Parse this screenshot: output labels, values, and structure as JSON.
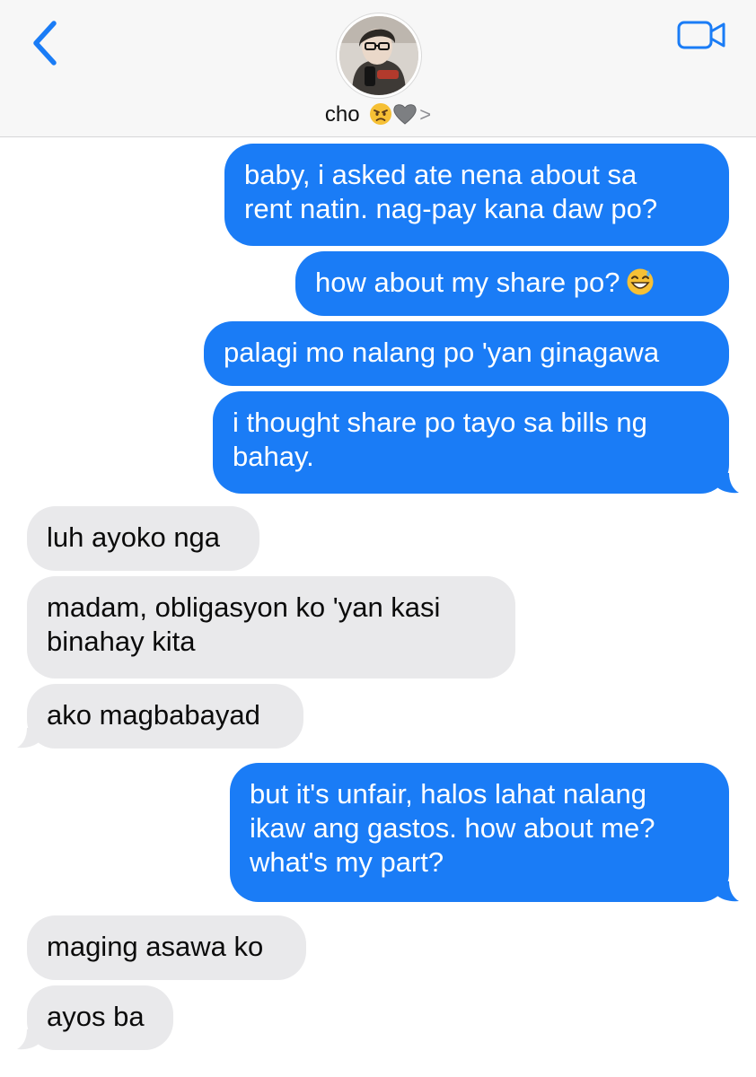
{
  "header": {
    "contact_name": "cho",
    "name_emojis": [
      "angry-face",
      "grey-heart"
    ],
    "chevron": ">",
    "back_icon": "chevron-left-icon",
    "video_icon": "video-camera-icon"
  },
  "colors": {
    "accent": "#1a7cf6",
    "outgoing_bubble": "#1a7cf6",
    "incoming_bubble": "#e9e9eb",
    "header_bg": "#f7f7f7"
  },
  "messages": [
    {
      "direction": "out",
      "lines": [
        "baby, i asked ate nena about sa",
        "rent natin. nag-pay kana daw po?"
      ]
    },
    {
      "direction": "out",
      "lines": [
        "how about my share po?"
      ],
      "emoji": "grinning-face-with-sweat"
    },
    {
      "direction": "out",
      "lines": [
        "palagi mo nalang po 'yan ginagawa"
      ]
    },
    {
      "direction": "out",
      "lines": [
        "i thought share po tayo sa bills ng",
        "bahay."
      ]
    },
    {
      "direction": "in",
      "lines": [
        "luh ayoko nga"
      ]
    },
    {
      "direction": "in",
      "lines": [
        "madam, obligasyon ko 'yan kasi",
        "binahay kita"
      ]
    },
    {
      "direction": "in",
      "lines": [
        "ako magbabayad"
      ]
    },
    {
      "direction": "out",
      "lines": [
        "but it's unfair, halos lahat nalang",
        "ikaw ang gastos. how about me?",
        "what's my part?"
      ]
    },
    {
      "direction": "in",
      "lines": [
        "maging asawa ko"
      ]
    },
    {
      "direction": "in",
      "lines": [
        "ayos ba"
      ]
    }
  ]
}
